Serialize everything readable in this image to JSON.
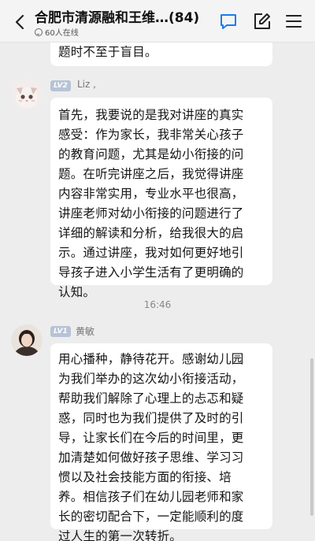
{
  "header": {
    "title": "合肥市清源融和王维…(84)",
    "online": "60人在线"
  },
  "messages": [
    {
      "lines": [
        "题时不至于盲目。"
      ]
    },
    {
      "level": "LV2",
      "nick": "Liz ,",
      "lines": [
        "首先，我要说的是我对讲座的真实",
        "感受：作为家长，我非常关心孩子",
        "的教育问题，尤其是幼小衔接的问",
        "题。在听完讲座之后，我觉得讲座",
        "内容非常实用，专业水平也很高，",
        "讲座老师对幼小衔接的问题进行了",
        "详细的解读和分析，给我很大的启",
        "示。通过讲座，我对如何更好地引",
        "导孩子进入小学生活有了更明确的",
        "认知。"
      ]
    },
    {
      "level": "LV1",
      "nick": "黄敏",
      "lines": [
        "用心播种，静待花开。感谢幼儿园",
        "为我们举办的这次幼小衔接活动，",
        "帮助我们解除了心理上的忐忑和疑",
        "惑，同时也为我们提供了及时的引",
        "导，让家长们在今后的时间里，更",
        "加清楚如何做好孩子思维、学习习",
        "惯以及社会技能方面的衔接、培",
        "养。相信孩子们在幼儿园老师和家",
        "长的密切配合下，一定能顺利的度",
        "过人生的第一次转折。"
      ]
    }
  ],
  "timestamp": "16:46",
  "icons": {
    "back": "chevron-left-icon",
    "chat": "chat-bubble-icon",
    "edit": "edit-icon",
    "menu": "menu-icon"
  }
}
